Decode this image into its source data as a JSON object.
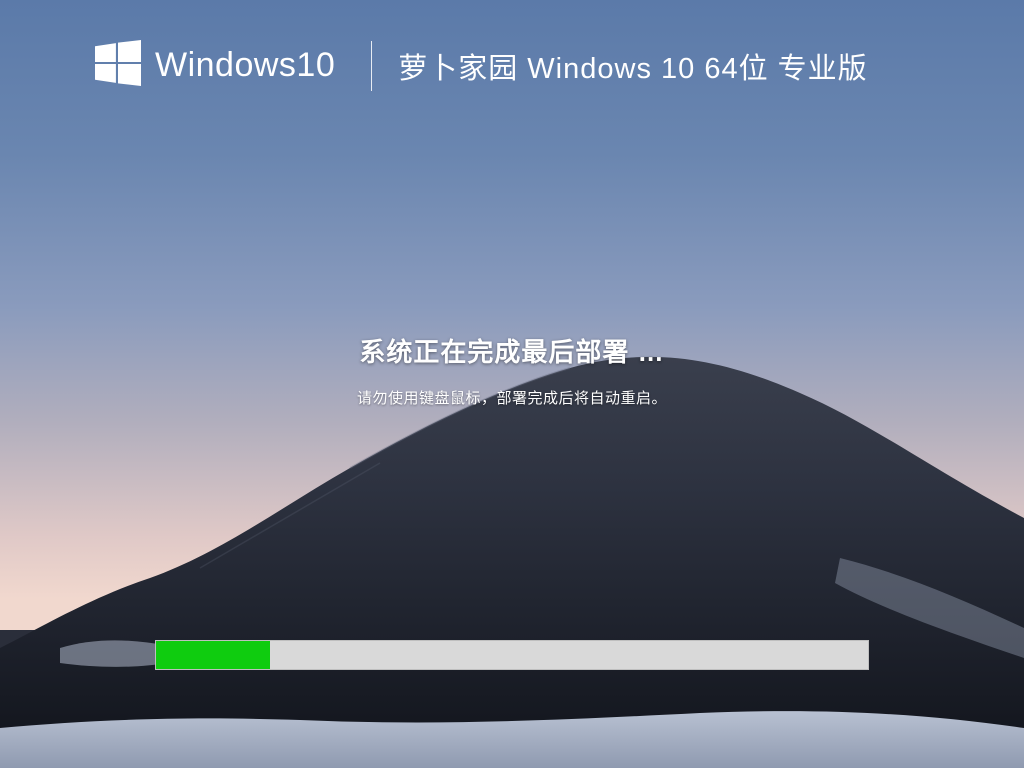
{
  "header": {
    "logo_text": "Windows10",
    "edition_text": "萝卜家园 Windows 10 64位 专业版"
  },
  "status": {
    "main": "系统正在完成最后部署 …",
    "sub": "请勿使用键盘鼠标，部署完成后将自动重启。"
  },
  "progress": {
    "percent": 16
  },
  "colors": {
    "progress_fill": "#0fcc0f",
    "progress_track": "#d9d9d9"
  }
}
